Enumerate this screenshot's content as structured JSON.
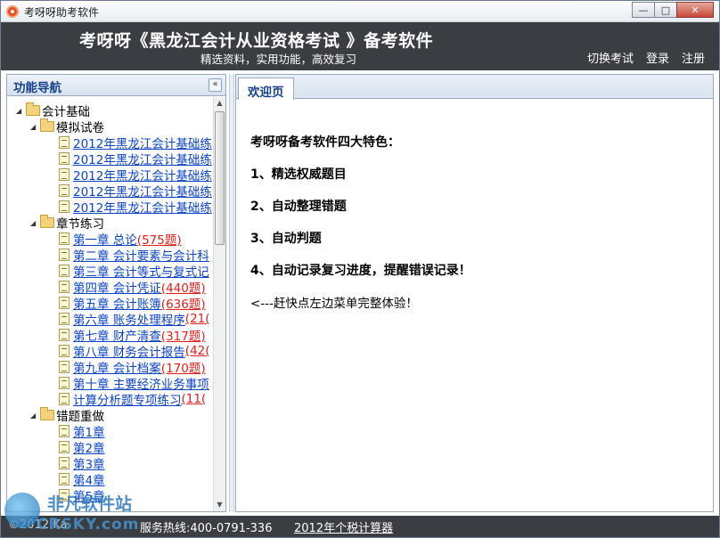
{
  "window": {
    "title": "考呀呀助考软件",
    "btn_min": "—",
    "btn_max": "□",
    "btn_close": "✕"
  },
  "banner": {
    "title": "考呀呀《黑龙江会计从业资格考试 》备考软件",
    "subtitle": "精选资料，实用功能，高效复习",
    "links": [
      "切换考试",
      "登录",
      "注册"
    ]
  },
  "nav": {
    "title": "功能导航",
    "collapse": "«",
    "tree": {
      "root": "会计基础",
      "mock_folder": "模拟试卷",
      "mock_items": [
        "2012年黑龙江会计基础练",
        "2012年黑龙江会计基础练",
        "2012年黑龙江会计基础练",
        "2012年黑龙江会计基础练",
        "2012年黑龙江会计基础练"
      ],
      "chapter_folder": "章节练习",
      "chapters": [
        {
          "label": "第一章  总论",
          "count": "(575题)"
        },
        {
          "label": "第二章  会计要素与会计科",
          "count": ""
        },
        {
          "label": "第三章  会计等式与复式记",
          "count": ""
        },
        {
          "label": "第四章  会计凭证",
          "count": "(440题)"
        },
        {
          "label": "第五章  会计账簿",
          "count": "(636题)"
        },
        {
          "label": "第六章  账务处理程序",
          "count": "(21("
        },
        {
          "label": "第七章  财产清查",
          "count": "(317题)"
        },
        {
          "label": "第八章  财务会计报告",
          "count": "(42("
        },
        {
          "label": "第九章  会计档案",
          "count": "(170题)"
        },
        {
          "label": "第十章  主要经济业务事项",
          "count": ""
        },
        {
          "label": "计算分析题专项练习",
          "count": "(11("
        }
      ],
      "wrong_folder": "错题重做",
      "wrong_items": [
        "第1章",
        "第2章",
        "第3章",
        "第4章",
        "第5章"
      ]
    }
  },
  "main": {
    "tab": "欢迎页",
    "heading": "考呀呀备考软件四大特色：",
    "features": [
      "1、精选权威题目",
      "2、自动整理错题",
      "3、自动判题",
      "4、自动记录复习进度，提醒错误记录！"
    ],
    "tip": "<---赶快点左边菜单完整体验！"
  },
  "status": {
    "copyright": "©2012 Ka",
    "hotline": "服务热线:400-0791-336",
    "calc_link": "2012年个税计算器"
  },
  "watermark": {
    "line1": "非凡软件站",
    "line2": "CRSKY.com"
  }
}
